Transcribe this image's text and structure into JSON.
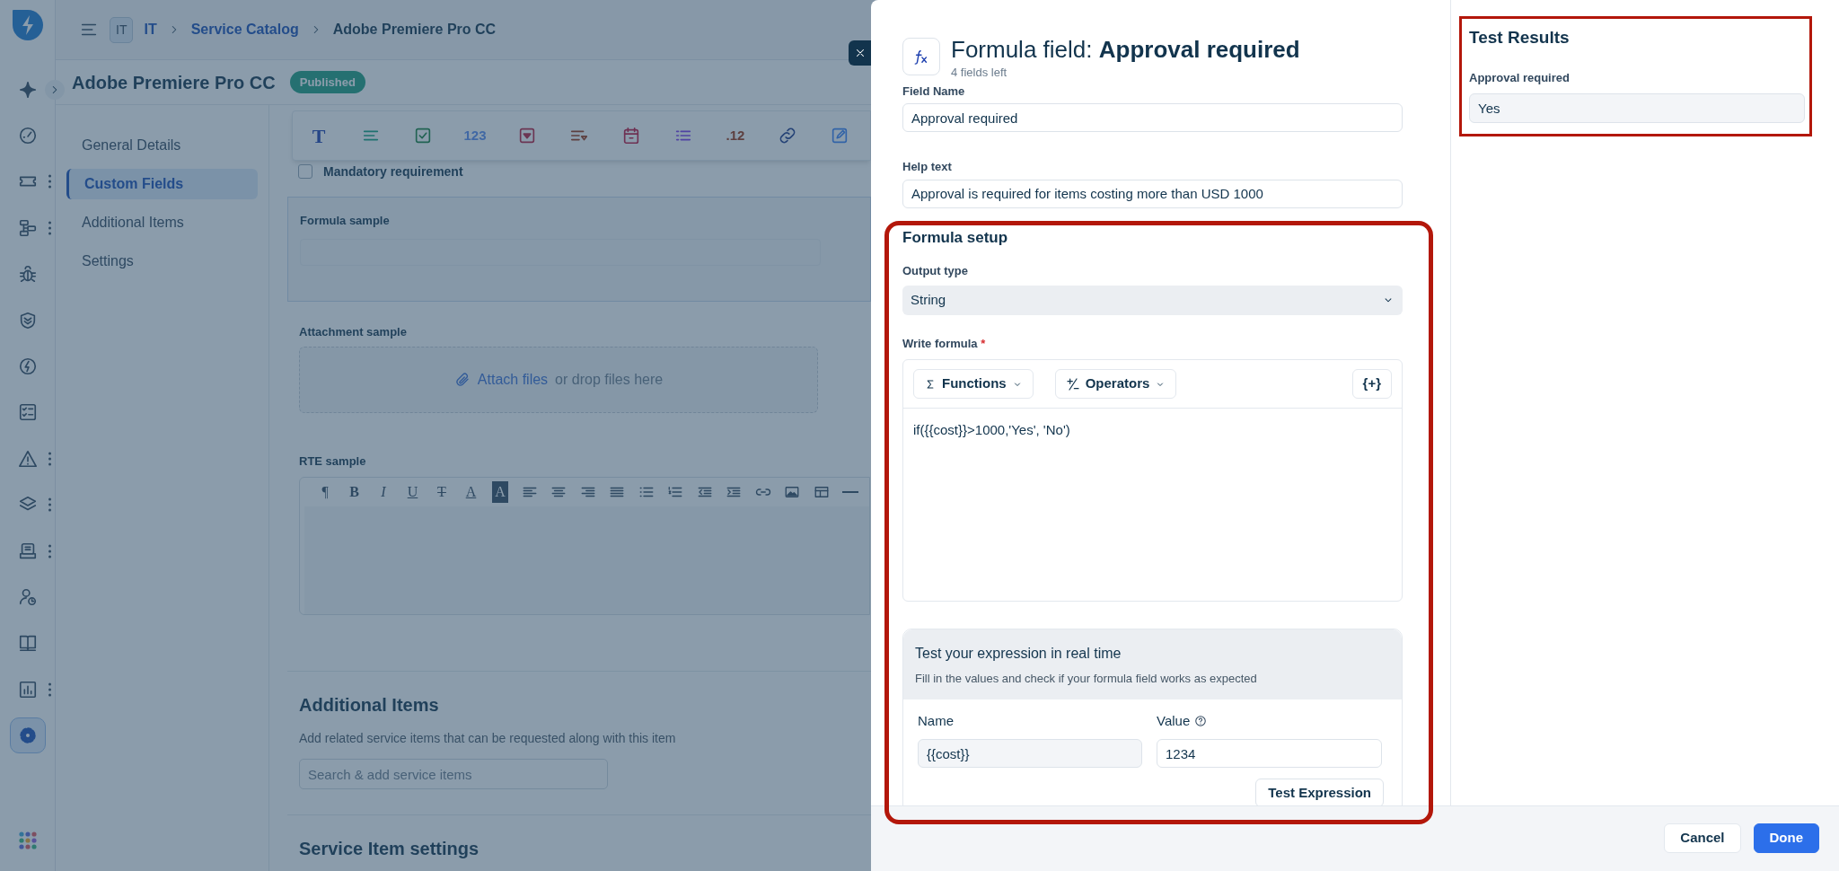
{
  "rail": {
    "items": [
      {
        "kind": "sparkle",
        "selected": false,
        "menu": false
      },
      {
        "kind": "gauge",
        "selected": false,
        "menu": false
      },
      {
        "kind": "ticket",
        "selected": false,
        "menu": true
      },
      {
        "kind": "diagram",
        "selected": false,
        "menu": true
      },
      {
        "kind": "bug",
        "selected": false,
        "menu": false
      },
      {
        "kind": "shield",
        "selected": false,
        "menu": false
      },
      {
        "kind": "bolt",
        "selected": false,
        "menu": false
      },
      {
        "kind": "checklist",
        "selected": false,
        "menu": false
      },
      {
        "kind": "warning",
        "selected": false,
        "menu": true
      },
      {
        "kind": "layers",
        "selected": false,
        "menu": true
      },
      {
        "kind": "laptop",
        "selected": false,
        "menu": true
      },
      {
        "kind": "person",
        "selected": false,
        "menu": false
      },
      {
        "kind": "book",
        "selected": false,
        "menu": false
      },
      {
        "kind": "chart",
        "selected": false,
        "menu": true
      },
      {
        "kind": "gear",
        "selected": true,
        "menu": false
      }
    ]
  },
  "breadcrumb": {
    "badge": "IT",
    "items": [
      "IT",
      "Service Catalog",
      "Adobe Premiere Pro CC"
    ]
  },
  "record": {
    "title": "Adobe Premiere Pro CC",
    "status": "Published"
  },
  "nav": [
    {
      "label": "General Details",
      "selected": false
    },
    {
      "label": "Custom Fields",
      "selected": true
    },
    {
      "label": "Additional Items",
      "selected": false
    },
    {
      "label": "Settings",
      "selected": false
    }
  ],
  "field_palette": [
    {
      "kind": "text",
      "label": "T"
    },
    {
      "kind": "paragraph"
    },
    {
      "kind": "checkbox"
    },
    {
      "kind": "number",
      "label": "123"
    },
    {
      "kind": "dropdown"
    },
    {
      "kind": "sort"
    },
    {
      "kind": "date"
    },
    {
      "kind": "list"
    },
    {
      "kind": "decimal",
      "label": ".12"
    },
    {
      "kind": "link"
    },
    {
      "kind": "edit"
    }
  ],
  "preview": {
    "checkbox": {
      "label": "Mandatory requirement",
      "checked": false
    },
    "formula_label": "Formula sample",
    "attachment": {
      "label": "Attachment sample",
      "link": "Attach files",
      "hint": "or drop files here"
    },
    "rte": {
      "label": "RTE sample",
      "tools": [
        {
          "kind": "glyph",
          "label": "¶"
        },
        {
          "kind": "glyph",
          "label": "B"
        },
        {
          "kind": "glyph",
          "label": "I"
        },
        {
          "kind": "glyph",
          "label": "U"
        },
        {
          "kind": "glyph",
          "label": "T"
        },
        {
          "kind": "glyph",
          "label": "A"
        },
        {
          "kind": "glyph",
          "label": "A"
        },
        {
          "kind": "align-left"
        },
        {
          "kind": "align-center"
        },
        {
          "kind": "align-right"
        },
        {
          "kind": "justify"
        },
        {
          "kind": "bullets"
        },
        {
          "kind": "numbers"
        },
        {
          "kind": "outdent"
        },
        {
          "kind": "indent"
        },
        {
          "kind": "link"
        },
        {
          "kind": "image"
        },
        {
          "kind": "table"
        },
        {
          "kind": "rule"
        }
      ]
    }
  },
  "additional_items": {
    "title": "Additional Items",
    "description": "Add related service items that can be requested along with this item",
    "placeholder": "Search & add service items"
  },
  "settings_title": "Service Item settings",
  "modal": {
    "title": "Formula field: **Approval required**",
    "subtitle": "4 fields left",
    "field_name": {
      "label": "Field Name",
      "value": "Approval required"
    },
    "help_text": {
      "label": "Help text",
      "value": "Approval is required for items costing more than USD 1000"
    },
    "setup": {
      "title": "Formula setup",
      "output_label": "Output type",
      "output_value": "String",
      "formula_label": "Write formula",
      "required_mark": "*",
      "toolbar": [
        {
          "kind": "sigma",
          "label": "Functions"
        },
        {
          "kind": "operators",
          "label": "Operators"
        },
        {
          "kind": "insert",
          "label": "{+}"
        }
      ],
      "formula": "if({{cost}}>1000,'Yes', 'No')",
      "test": {
        "title": "Test your expression in real time",
        "description": "Fill in the values and check if your formula field works as expected",
        "name_label": "Name",
        "value_label": "Value",
        "name_value": "{{cost}}",
        "value_value": "1234",
        "button": "Test Expression"
      }
    },
    "results": {
      "title": "Test Results",
      "label": "Approval required",
      "value": "Yes"
    },
    "buttons": [
      {
        "kind": "secondary",
        "label": "Cancel"
      },
      {
        "kind": "primary",
        "label": "Done"
      }
    ]
  }
}
